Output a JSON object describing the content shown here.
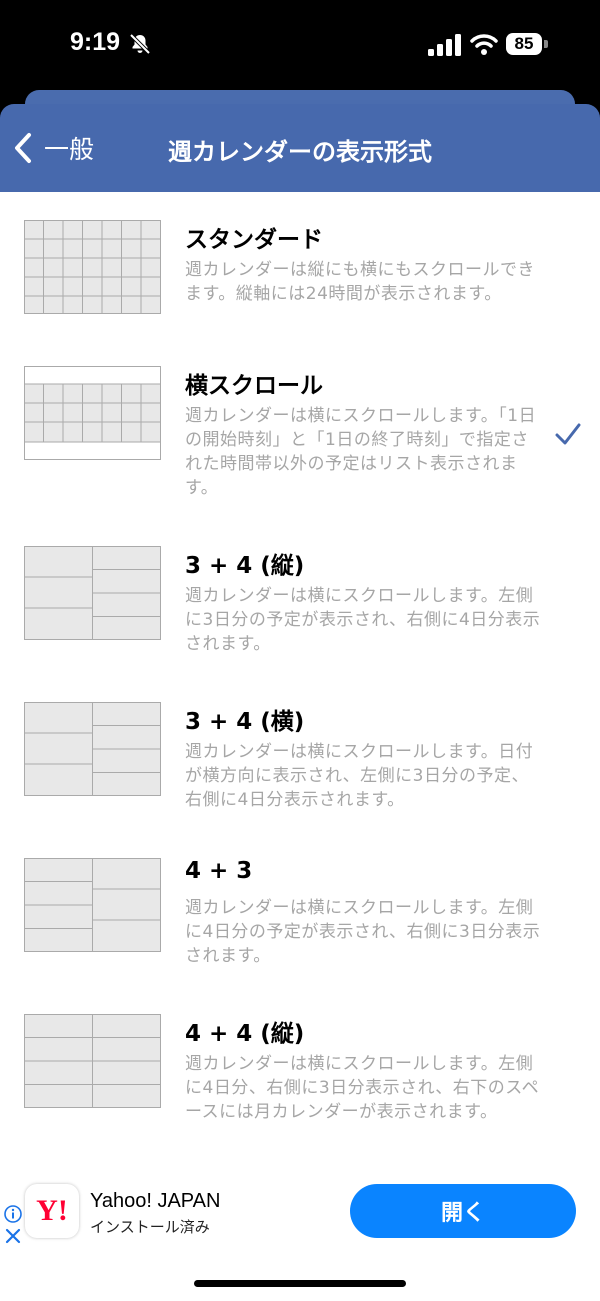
{
  "status": {
    "time": "9:19",
    "battery": "85"
  },
  "nav": {
    "back_label": "一般",
    "title": "週カレンダーの表示形式"
  },
  "items": [
    {
      "title": "スタンダード",
      "desc": "週カレンダーは縦にも横にもスクロールできます。縦軸には24時間が表示されます。",
      "selected": false
    },
    {
      "title": "横スクロール",
      "desc": "週カレンダーは横にスクロールします。「1日の開始時刻」と「1日の終了時刻」で指定された時間帯以外の予定はリスト表示されます。",
      "selected": true
    },
    {
      "title": "3 + 4 (縦)",
      "desc": "週カレンダーは横にスクロールします。左側に3日分の予定が表示され、右側に4日分表示されます。",
      "selected": false
    },
    {
      "title": "3 + 4 (横)",
      "desc": "週カレンダーは横にスクロールします。日付が横方向に表示され、左側に3日分の予定、右側に4日分表示されます。",
      "selected": false
    },
    {
      "title": "4 + 3",
      "desc": "週カレンダーは横にスクロールします。左側に4日分の予定が表示され、右側に3日分表示されます。",
      "selected": false
    },
    {
      "title": "4 + 4 (縦)",
      "desc": "週カレンダーは横にスクロールします。左側に4日分、右側に3日分表示され、右下のスペースには月カレンダーが表示されます。",
      "selected": false
    }
  ],
  "ad": {
    "app_name": "Yahoo! JAPAN",
    "status": "インストール済み",
    "open_label": "開く",
    "logo_text": "Y!"
  },
  "colors": {
    "nav": "#4769ad",
    "check": "#4769ad",
    "open_button": "#0a84ff"
  }
}
